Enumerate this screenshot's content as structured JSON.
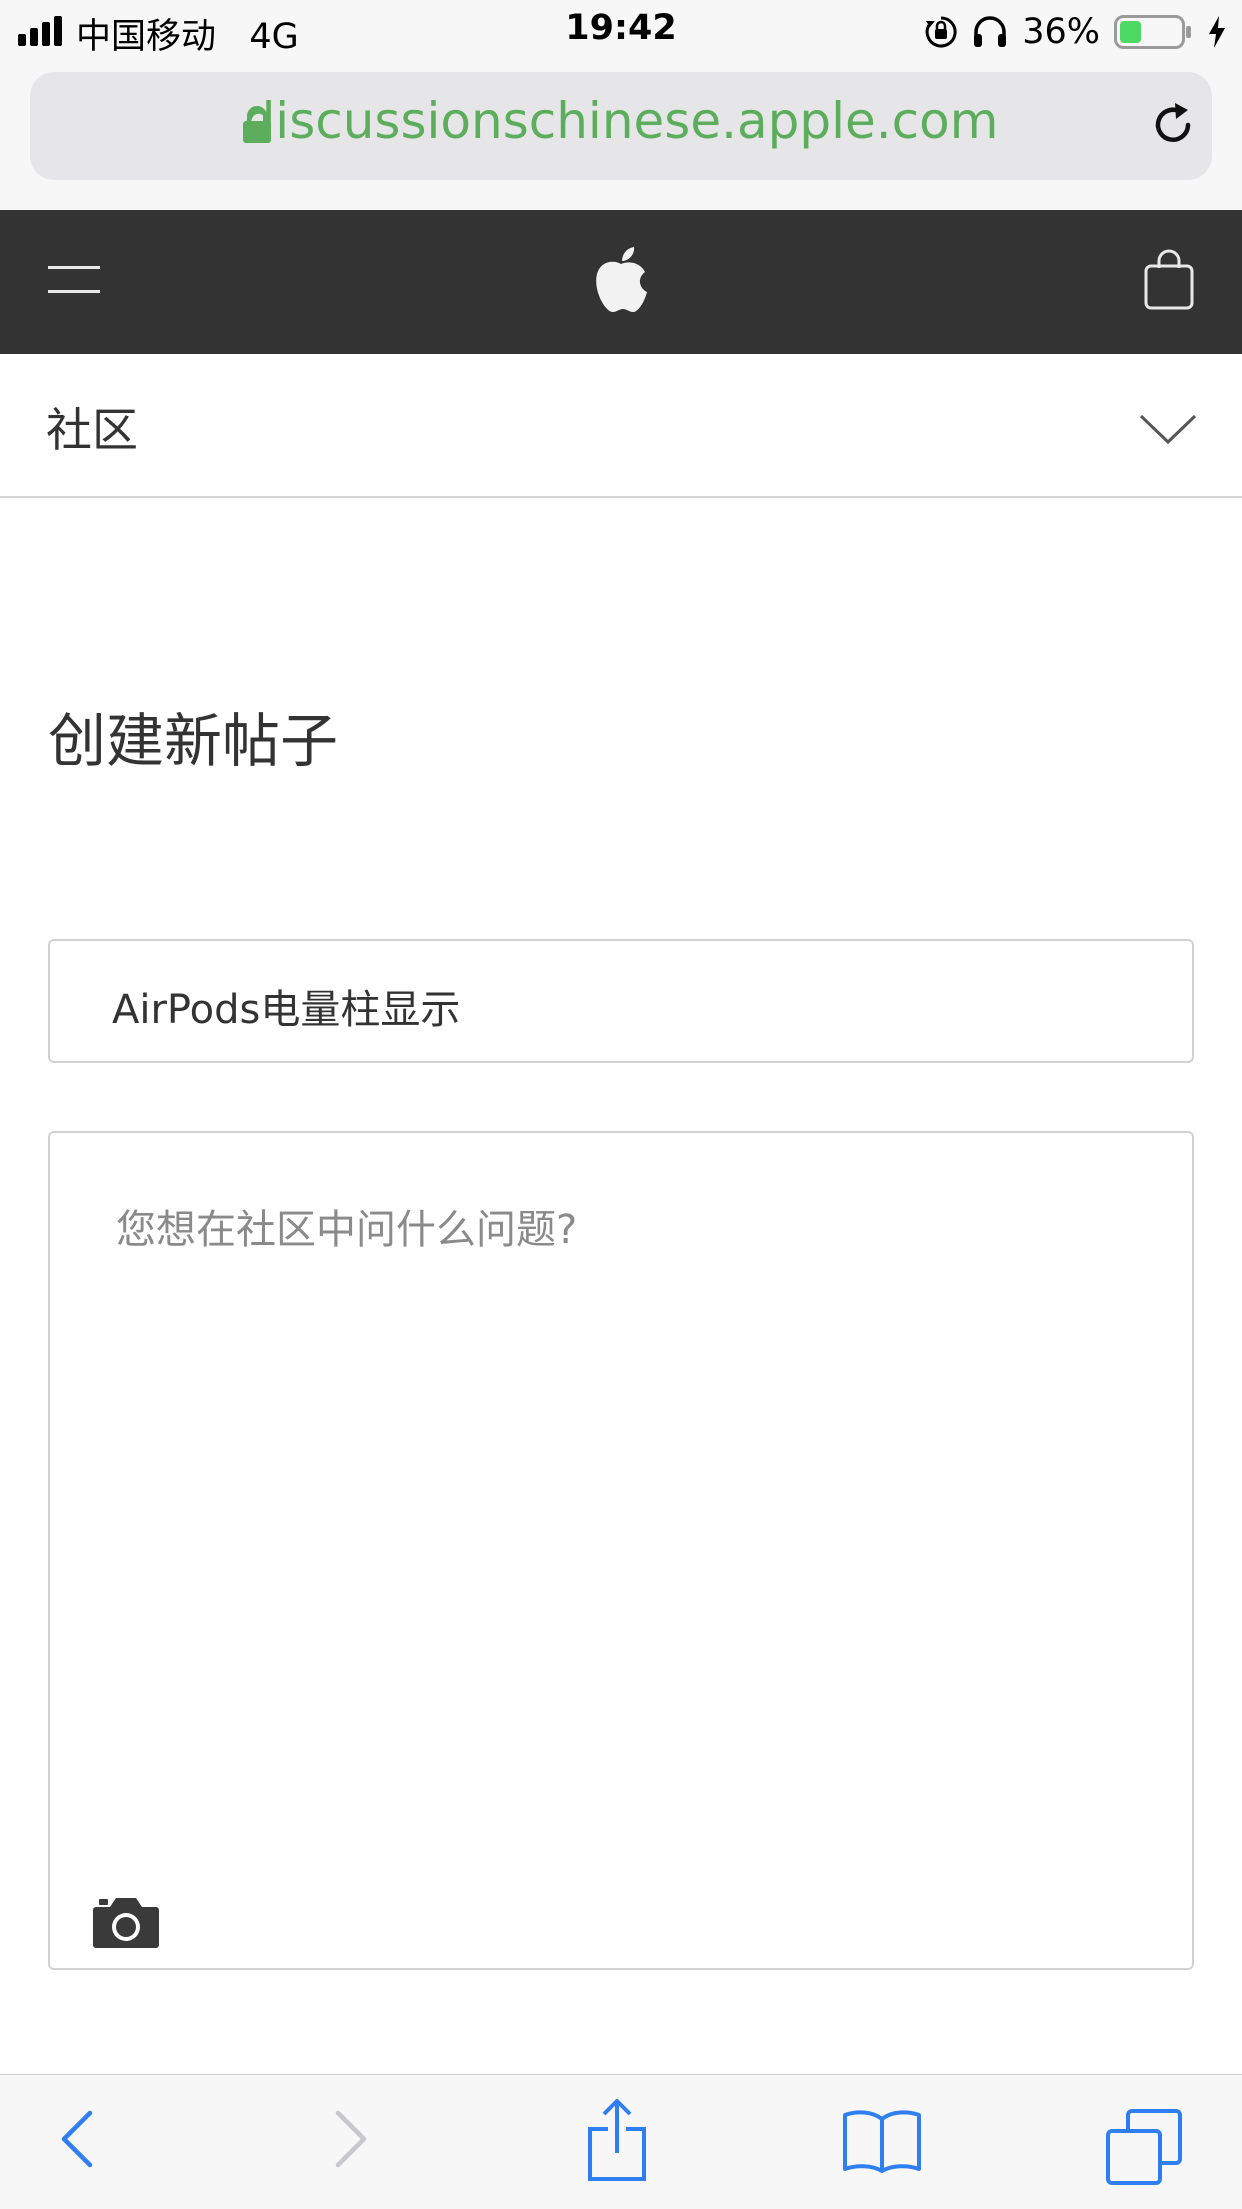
{
  "status_bar": {
    "carrier": "中国移动",
    "network": "4G",
    "time": "19:42",
    "battery_percent": "36%",
    "battery_level": 0.36,
    "battery_color": "#4cd964"
  },
  "browser": {
    "url": "discussionschinese.apple.com",
    "url_color": "#5cad5c"
  },
  "global_nav": {
    "background": "#333333",
    "icons": [
      "menu-icon",
      "apple-logo-icon",
      "shopping-bag-icon"
    ]
  },
  "community_nav": {
    "title": "社区"
  },
  "page": {
    "title": "创建新帖子",
    "subject_value": "AirPods电量柱显示",
    "body_placeholder": "您想在社区中问什么问题?"
  },
  "toolbar": {
    "accent": "#2f7ef2",
    "items": [
      "back-icon",
      "forward-icon",
      "share-icon",
      "bookmarks-icon",
      "tabs-icon"
    ]
  }
}
